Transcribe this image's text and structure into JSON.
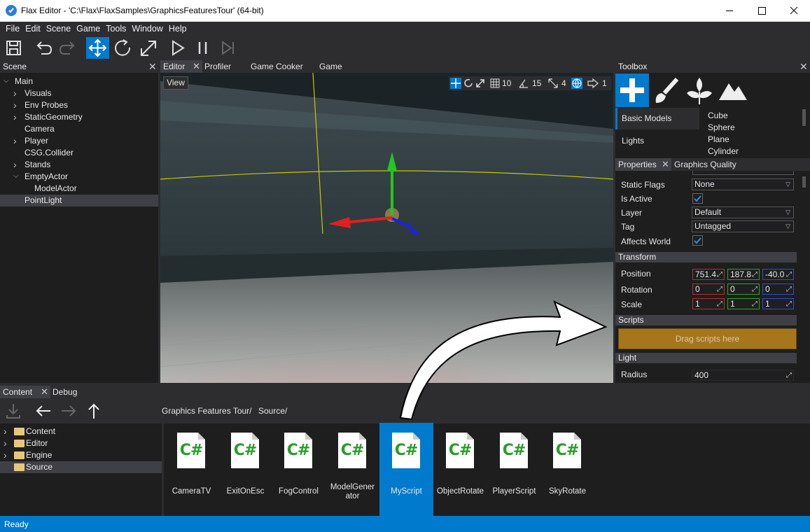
{
  "window": {
    "title": "Flax Editor - 'C:\\Flax\\FlaxSamples\\GraphicsFeaturesTour' (64-bit)"
  },
  "menu": [
    "File",
    "Edit",
    "Scene",
    "Game",
    "Tools",
    "Window",
    "Help"
  ],
  "toolbar": {
    "icons": [
      "save-icon",
      "undo-icon",
      "redo-icon",
      "translate-icon",
      "rotate-icon",
      "scale-icon",
      "play-icon",
      "pause-icon",
      "step-icon"
    ]
  },
  "scene": {
    "title": "Scene",
    "items": [
      {
        "label": "Main",
        "expandable": true,
        "expanded": true
      },
      {
        "label": "Visuals",
        "expandable": true
      },
      {
        "label": "Env Probes",
        "expandable": true
      },
      {
        "label": "StaticGeometry",
        "expandable": true
      },
      {
        "label": "Camera",
        "expandable": false
      },
      {
        "label": "Player",
        "expandable": true
      },
      {
        "label": "CSG.Collider",
        "expandable": false
      },
      {
        "label": "Stands",
        "expandable": true
      },
      {
        "label": "EmptyActor",
        "expandable": true,
        "expanded": true
      },
      {
        "label": "ModelActor",
        "expandable": false
      },
      {
        "label": "PointLight",
        "expandable": false,
        "selected": true
      }
    ]
  },
  "viewport_tabs": [
    "Editor",
    "Profiler",
    "Game Cooker",
    "Game"
  ],
  "viewport": {
    "view_button": "View",
    "grid_snap": "10",
    "rotate_snap": "15",
    "scale_snap": "4",
    "camera_speed": "1"
  },
  "toolbox": {
    "title": "Toolbox",
    "categories": [
      "Basic Models",
      "Lights"
    ],
    "items": [
      "Cube",
      "Sphere",
      "Plane",
      "Cylinder"
    ]
  },
  "properties": {
    "tabs": [
      "Properties",
      "Graphics Quality"
    ],
    "static_flags_label": "Static Flags",
    "static_flags_value": "None",
    "is_active_label": "Is Active",
    "layer_label": "Layer",
    "layer_value": "Default",
    "tag_label": "Tag",
    "tag_value": "Untagged",
    "affects_world_label": "Affects World",
    "transform_header": "Transform",
    "position_label": "Position",
    "position": [
      "751.4",
      "187.8",
      "-40.0"
    ],
    "rotation_label": "Rotation",
    "rotation": [
      "0",
      "0",
      "0"
    ],
    "scale_label": "Scale",
    "scale": [
      "1",
      "1",
      "1"
    ],
    "scripts_header": "Scripts",
    "drag_scripts": "Drag scripts here",
    "light_header": "Light",
    "radius_label": "Radius",
    "radius_value": "400"
  },
  "content": {
    "tabs": [
      "Content",
      "Debug"
    ],
    "breadcrumb": [
      "Graphics Features Tour/",
      "Source/"
    ],
    "folders": [
      "Content",
      "Editor",
      "Engine",
      "Source"
    ],
    "assets": [
      "CameraTV",
      "ExitOnEsc",
      "FogControl",
      "ModelGenerator",
      "MyScript",
      "ObjectRotate",
      "PlayerScript",
      "SkyRotate"
    ],
    "asset_icon_text": "C#",
    "selected_asset": "MyScript"
  },
  "status": "Ready",
  "colors": {
    "accent": "#007acc",
    "panel": "#1e1e1e",
    "header": "#2d2d30",
    "scripts_drop": "#a6761d",
    "asset_green": "#2a9d2a"
  }
}
